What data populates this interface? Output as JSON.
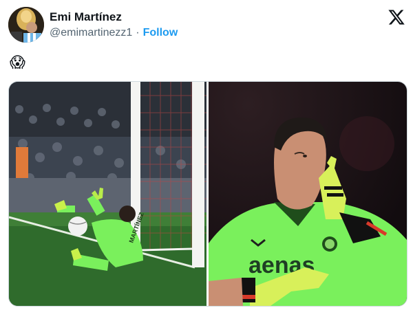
{
  "tweet": {
    "author_name": "Emi Martínez",
    "handle": "@emimartinezz1",
    "separator": "·",
    "follow_label": "Follow",
    "body_emoji": "😱",
    "platform_icon": "x-logo-icon"
  },
  "media": {
    "images": [
      {
        "name": "penalty-save-photo"
      },
      {
        "name": "shush-gesture-photo",
        "shirt_text": "aenas"
      }
    ]
  },
  "colors": {
    "link": "#1d9bf0",
    "secondary_text": "#536471",
    "kit_green": "#7af05c"
  }
}
